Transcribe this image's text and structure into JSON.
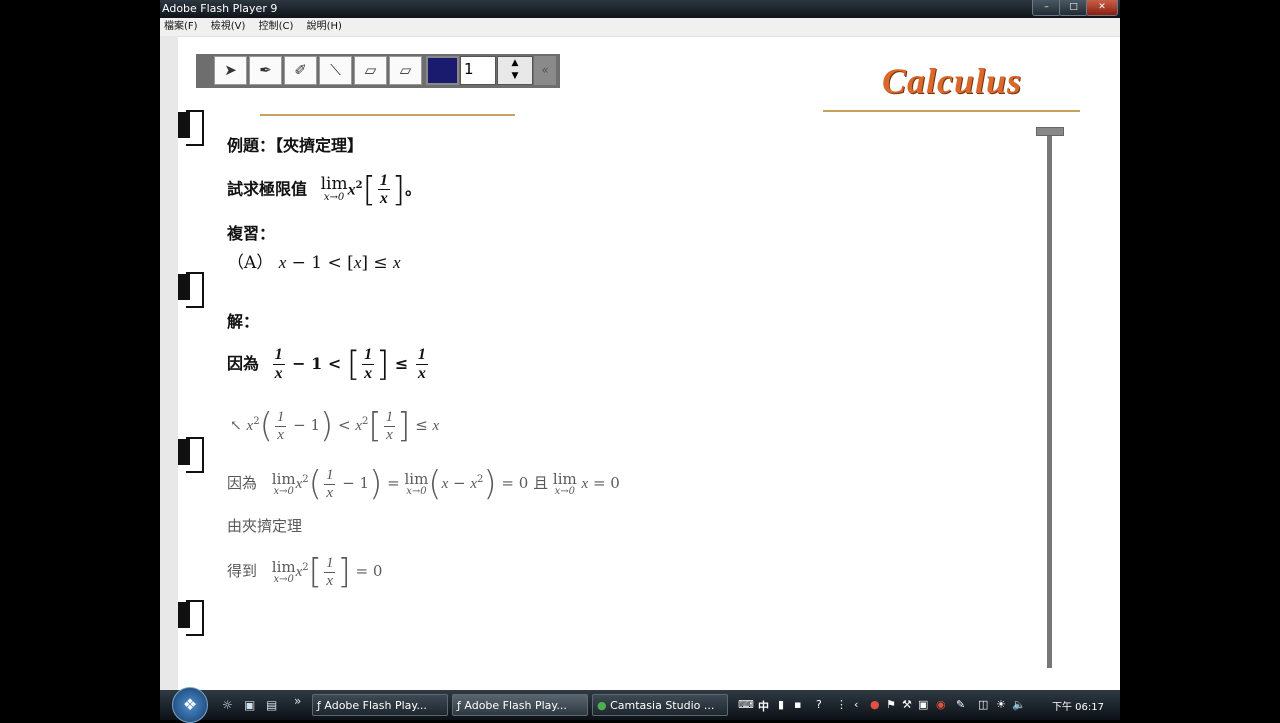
{
  "window": {
    "title": "Adobe Flash Player 9"
  },
  "menu": [
    "檔案(F)",
    "檢視(V)",
    "控制(C)",
    "說明(H)"
  ],
  "toolbar": {
    "line_width": "1"
  },
  "logo": "Calculus",
  "content": {
    "example_label": "例題：【夾擠定理】",
    "problem_lead": "試求極限值",
    "period": "。",
    "review_label": "複習：",
    "review_item_label": "（A）",
    "solution_label": "解：",
    "because": "因為",
    "because2": "因為",
    "and_label": "且",
    "squeeze_line": "由夾擠定理",
    "result_lead": "得到",
    "lim": "lim",
    "lim_sub": "x→0",
    "one": "1",
    "zero": "0",
    "x": "x",
    "two": "2"
  },
  "taskbar": {
    "tasks": [
      "Adobe Flash Play...",
      "Adobe Flash Play...",
      "Camtasia Studio ..."
    ],
    "ime": "中",
    "clock": "下午 06:17"
  },
  "colors": {
    "accent_orange": "#d9682a",
    "pen_color": "#1a1a6e",
    "rule_gold": "#c8a060"
  }
}
